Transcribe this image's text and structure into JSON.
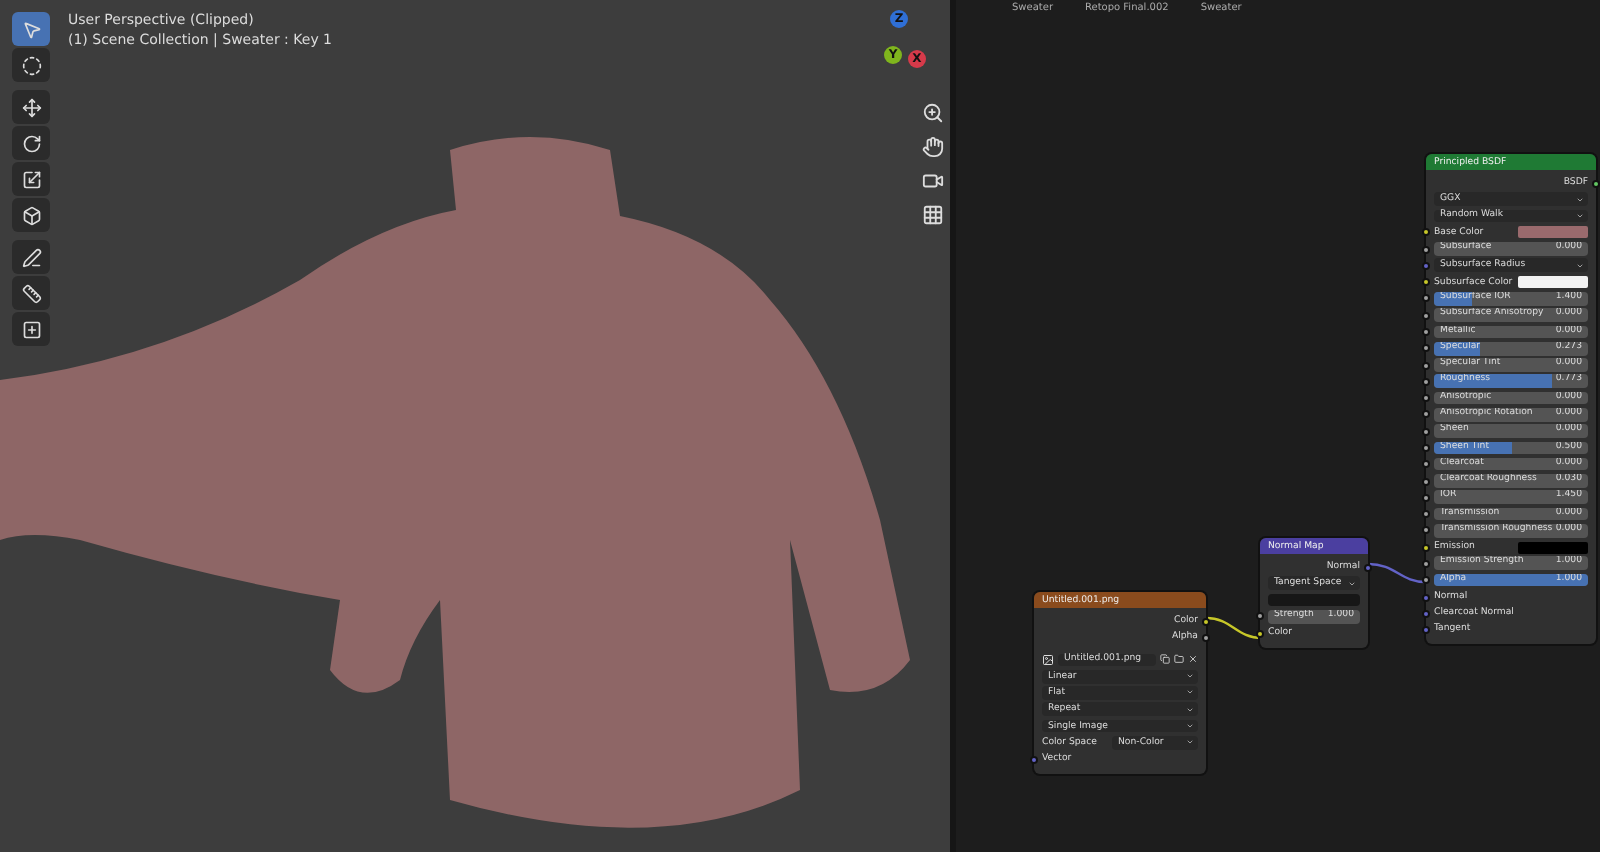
{
  "viewport": {
    "title": "User Perspective (Clipped)",
    "subtitle": "(1) Scene Collection | Sweater : Key 1",
    "tools": [
      {
        "selected": true
      },
      {
        "selected": false
      },
      {
        "selected": false
      },
      {
        "selected": false
      },
      {
        "selected": false
      },
      {
        "selected": false
      },
      {
        "selected": false
      },
      {
        "selected": false
      },
      {
        "selected": false
      }
    ],
    "gizmo_axes": [
      {
        "label": "Z",
        "color": "#2f6fd6"
      },
      {
        "label": "Y",
        "color": "#7fb51d"
      },
      {
        "label": "X",
        "color": "#d63a4a"
      }
    ]
  },
  "node_editor": {
    "breadcrumbs": [
      "Sweater",
      "Retopo Final.002",
      "Sweater"
    ],
    "principled": {
      "title": "Principled BSDF",
      "output": "BSDF",
      "dropdowns": [
        "GGX",
        "Random Walk"
      ],
      "inputs": [
        {
          "kind": "color",
          "label": "Base Color",
          "color": "#9a6a6d"
        },
        {
          "kind": "slider",
          "label": "Subsurface",
          "value": "0.000",
          "level": 0
        },
        {
          "kind": "menu",
          "label": "Subsurface Radius"
        },
        {
          "kind": "color",
          "label": "Subsurface Color",
          "color": "#f2f2f2"
        },
        {
          "kind": "slider",
          "label": "Subsurface IOR",
          "value": "1.400",
          "level": 0.25
        },
        {
          "kind": "slider",
          "label": "Subsurface Anisotropy",
          "value": "0.000",
          "level": 0
        },
        {
          "kind": "slider",
          "label": "Metallic",
          "value": "0.000",
          "level": 0
        },
        {
          "kind": "slider",
          "label": "Specular",
          "value": "0.273",
          "level": 0.3
        },
        {
          "kind": "slider",
          "label": "Specular Tint",
          "value": "0.000",
          "level": 0
        },
        {
          "kind": "slider",
          "label": "Roughness",
          "value": "0.773",
          "level": 0.77
        },
        {
          "kind": "slider",
          "label": "Anisotropic",
          "value": "0.000",
          "level": 0
        },
        {
          "kind": "slider",
          "label": "Anisotropic Rotation",
          "value": "0.000",
          "level": 0
        },
        {
          "kind": "slider",
          "label": "Sheen",
          "value": "0.000",
          "level": 0
        },
        {
          "kind": "slider",
          "label": "Sheen Tint",
          "value": "0.500",
          "level": 0.5
        },
        {
          "kind": "slider",
          "label": "Clearcoat",
          "value": "0.000",
          "level": 0
        },
        {
          "kind": "slider",
          "label": "Clearcoat Roughness",
          "value": "0.030",
          "level": 0
        },
        {
          "kind": "slider",
          "label": "IOR",
          "value": "1.450",
          "level": 0
        },
        {
          "kind": "slider",
          "label": "Transmission",
          "value": "0.000",
          "level": 0
        },
        {
          "kind": "slider",
          "label": "Transmission Roughness",
          "value": "0.000",
          "level": 0
        },
        {
          "kind": "color",
          "label": "Emission",
          "color": "#000000"
        },
        {
          "kind": "slider",
          "label": "Emission Strength",
          "value": "1.000",
          "level": 0
        },
        {
          "kind": "slider",
          "label": "Alpha",
          "value": "1.000",
          "level": 1
        },
        {
          "kind": "socket",
          "label": "Normal"
        },
        {
          "kind": "socket",
          "label": "Clearcoat Normal"
        },
        {
          "kind": "socket",
          "label": "Tangent"
        }
      ]
    },
    "normal_map": {
      "title": "Normal Map",
      "output": "Normal",
      "dropdown": "Tangent Space",
      "strength": {
        "label": "Strength",
        "value": "1.000"
      },
      "input": "Color"
    },
    "image_texture": {
      "title": "Untitled.001.png",
      "outputs": [
        "Color",
        "Alpha"
      ],
      "image_name": "Untitled.001.png",
      "dropdowns": [
        "Linear",
        "Flat",
        "Repeat",
        "Single Image"
      ],
      "color_space_label": "Color Space",
      "color_space": "Non-Color",
      "input": "Vector"
    }
  }
}
